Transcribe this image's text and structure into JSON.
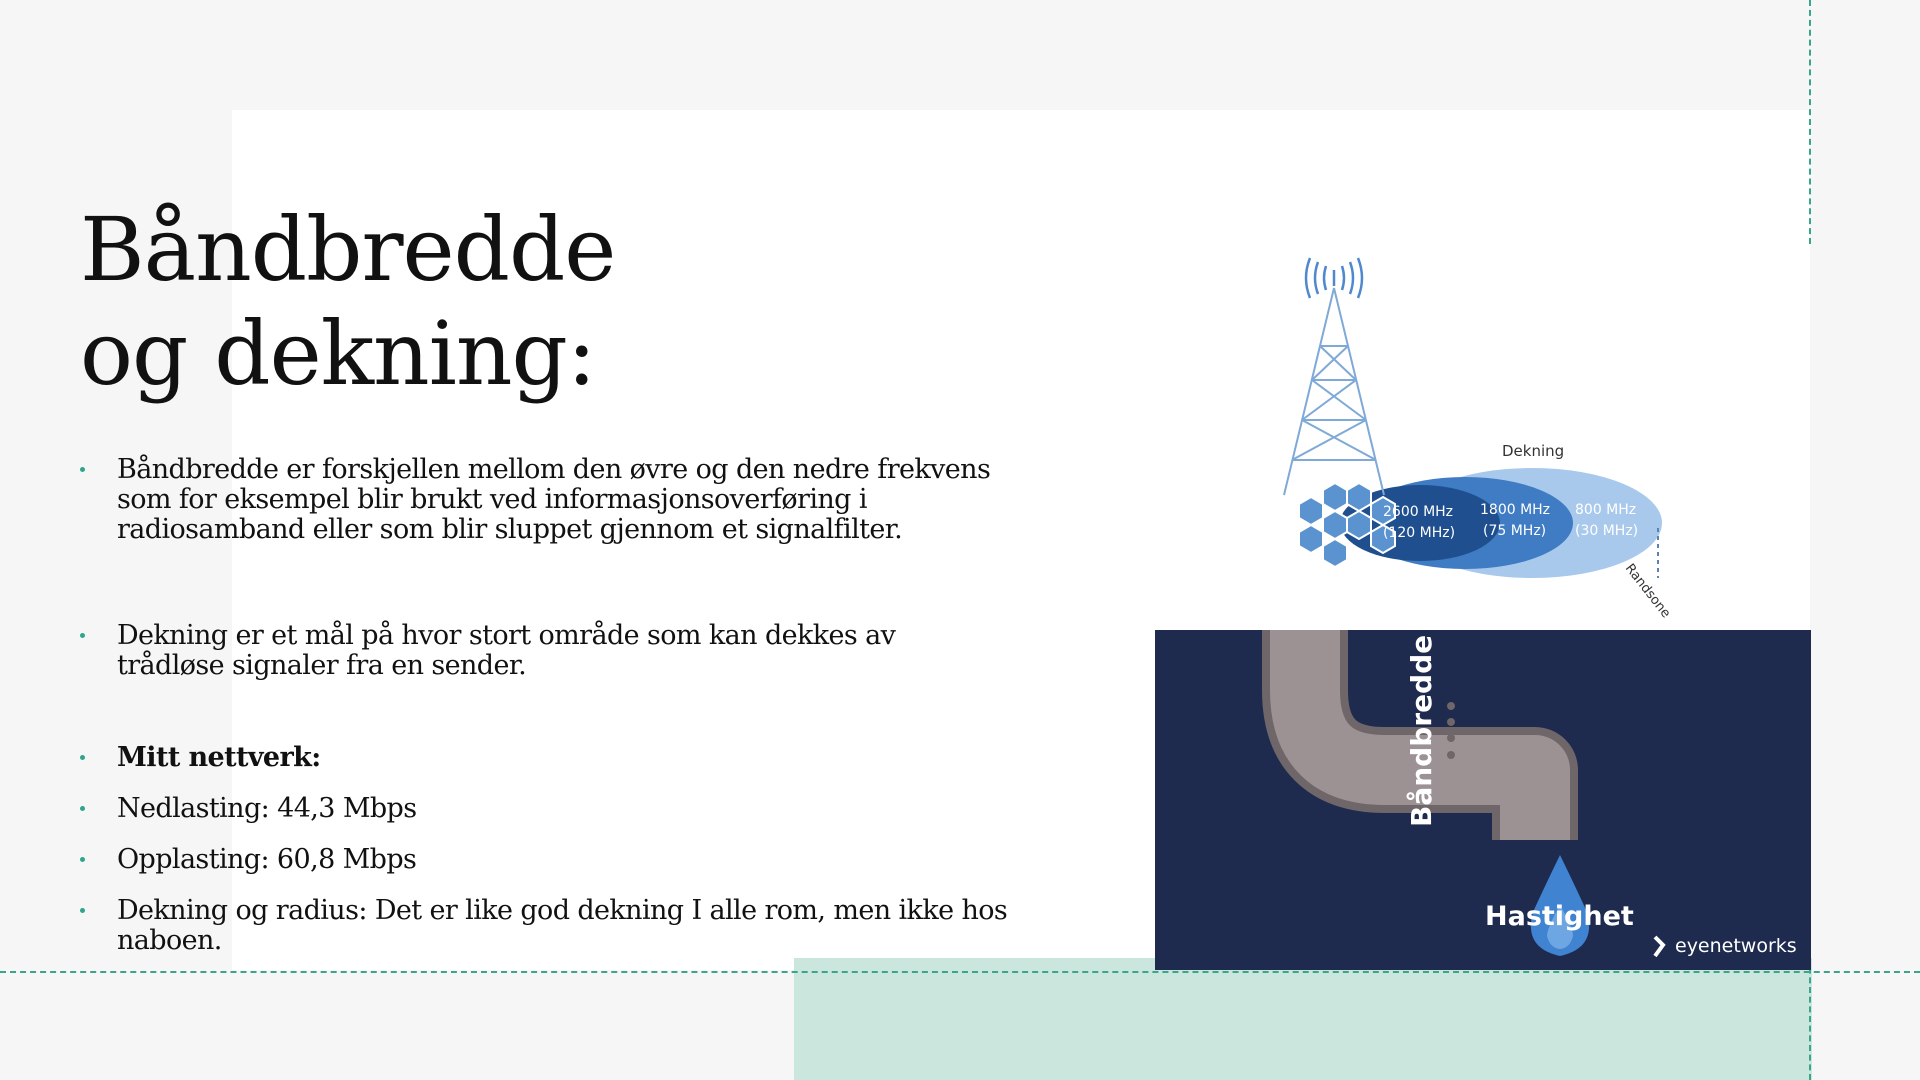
{
  "slide": {
    "title_line1": "Båndbredde",
    "title_line2": "og dekning:",
    "bullets": [
      "Båndbredde er forskjellen mellom den øvre og den nedre frekvens som for eksempel blir brukt ved informasjonsoverføring i radiosamband eller som blir sluppet gjennom et signalfilter.",
      "Dekning er et mål på hvor stort område som kan dekkes av trådløse signaler fra en sender.",
      "Mitt nettverk:",
      "Nedlasting: 44,3 Mbps",
      "Opplasting: 60,8 Mbps",
      "Dekning og radius: Det er like god dekning I alle rom, men ikke hos naboen."
    ]
  },
  "coverage_figure": {
    "heading": "Dekning",
    "band1_freq": "2600 MHz",
    "band1_bw": "(120 MHz)",
    "band2_freq": "1800 MHz",
    "band2_bw": "(75 MHz)",
    "band3_freq": "800 MHz",
    "band3_bw": "(30 MHz)",
    "edge_label": "Randsone",
    "colors": {
      "band1": "#1f4f8e",
      "band2": "#3f7cc4",
      "band3": "#a9c9ec",
      "tower": "#7fa9d6",
      "cells": "#5b93d1"
    }
  },
  "pipe_figure": {
    "pipe_label": "Båndbredde",
    "drop_label": "Hastighet",
    "brand": "eyenetworks",
    "colors": {
      "background": "#1e2a4e",
      "pipe": "#9c9294",
      "pipe_edge": "#6e6668",
      "drop": "#3f83d1"
    }
  },
  "theme": {
    "accent": "#2fa58c",
    "mint": "#cbe6dc"
  }
}
